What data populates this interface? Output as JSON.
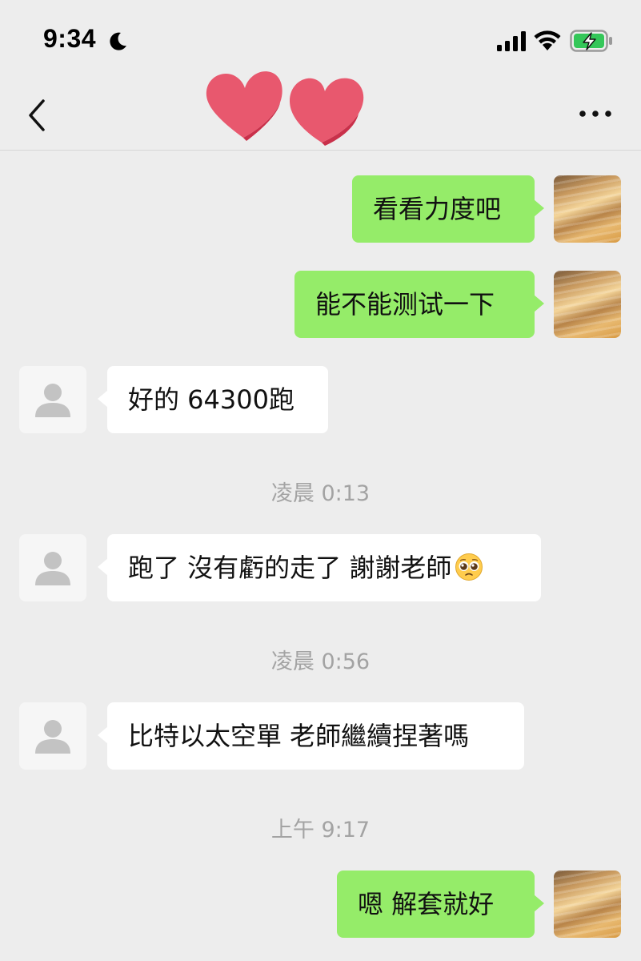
{
  "status_bar": {
    "time": "9:34",
    "icons": [
      "moon-icon",
      "cellular-signal-icon",
      "wifi-icon",
      "battery-charging-icon"
    ],
    "battery_color": "#34c759"
  },
  "nav": {
    "back_icon": "chevron-left-icon",
    "title_icon": "two-hearts-icon",
    "more_icon": "more-dots-icon",
    "heart_color": "#e8586e"
  },
  "messages": [
    {
      "side": "self",
      "text": "看看力度吧"
    },
    {
      "side": "self",
      "text": "能不能测试一下"
    },
    {
      "side": "other",
      "text": "好的 64300跑"
    },
    {
      "timestamp": "凌晨 0:13"
    },
    {
      "side": "other",
      "text": "跑了 沒有虧的走了 謝謝老師",
      "emoji": "pleading-face-icon"
    },
    {
      "timestamp": "凌晨 0:56"
    },
    {
      "side": "other",
      "text": "比特以太空單 老師繼續捏著嗎"
    },
    {
      "timestamp": "上午 9:17"
    },
    {
      "side": "self",
      "text": "嗯 解套就好"
    }
  ],
  "colors": {
    "background": "#ededed",
    "self_bubble": "#95ec69",
    "other_bubble": "#ffffff",
    "timestamp_text": "#a3a3a3"
  }
}
